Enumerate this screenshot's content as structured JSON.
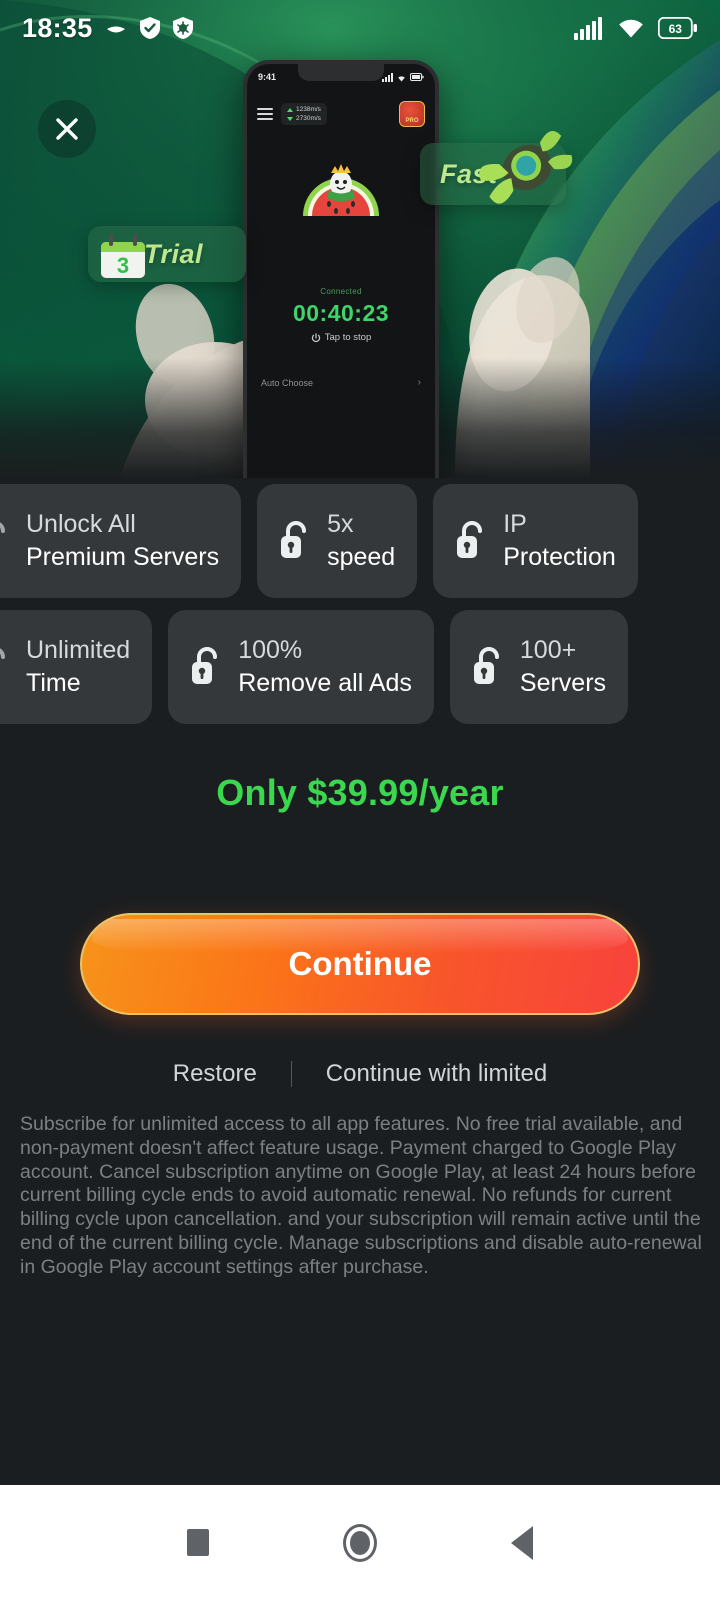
{
  "statusbar": {
    "time": "18:35",
    "battery_percent": "63",
    "icons": [
      "moon-icon",
      "shield-check-icon",
      "security-bug-icon",
      "signal-icon",
      "wifi-icon",
      "battery-icon"
    ]
  },
  "hero": {
    "close_label": "✕",
    "badges": [
      {
        "text": "Trial",
        "icon": "calendar-icon",
        "icon_value": "3"
      },
      {
        "text": "Fast",
        "icon": "rocket-icon"
      }
    ],
    "phone": {
      "status_time": "9:41",
      "upload_speed": "1238m/s",
      "download_speed": "2730m/s",
      "pro_label": "PRO",
      "connected_label": "Connected",
      "timer": "00:40:23",
      "stop_label": "Tap to stop",
      "server_label": "Auto Choose",
      "chevron": "›"
    }
  },
  "features": {
    "row1": [
      {
        "line1": "Unlock All",
        "line2": "Premium Servers",
        "icon": "unlock-icon"
      },
      {
        "line1": "5x",
        "line2": "speed",
        "icon": "unlock-icon"
      },
      {
        "line1": "IP",
        "line2": "Protection",
        "icon": "unlock-icon"
      }
    ],
    "row2": [
      {
        "line1": "Unlimited",
        "line2": "Time",
        "icon": "unlock-icon"
      },
      {
        "line1": "100%",
        "line2": "Remove all Ads",
        "icon": "unlock-icon"
      },
      {
        "line1": "100+",
        "line2": "Servers",
        "icon": "unlock-icon"
      }
    ]
  },
  "price": {
    "text": "Only $39.99/year",
    "color": "#3ad84f"
  },
  "cta": {
    "label": "Continue",
    "gradient_start": "#f7931a",
    "gradient_end": "#f8423c",
    "border_color": "#e8c56b"
  },
  "links": {
    "restore": "Restore",
    "limited": "Continue with limited"
  },
  "legal": {
    "text": "Subscribe for unlimited access to all app features. No free trial available, and non-payment doesn't affect feature usage. Payment charged to Google Play account. Cancel subscription anytime on Google Play, at least 24 hours before current billing cycle ends to avoid automatic renewal. No refunds for current billing cycle upon cancellation. and your subscription will remain active until the end of the current billing cycle. Manage subscriptions and disable auto-renewal in Google Play account settings after purchase."
  },
  "navbar": {
    "recents": "recents-square-icon",
    "home": "home-circle-icon",
    "back": "back-triangle-icon"
  }
}
